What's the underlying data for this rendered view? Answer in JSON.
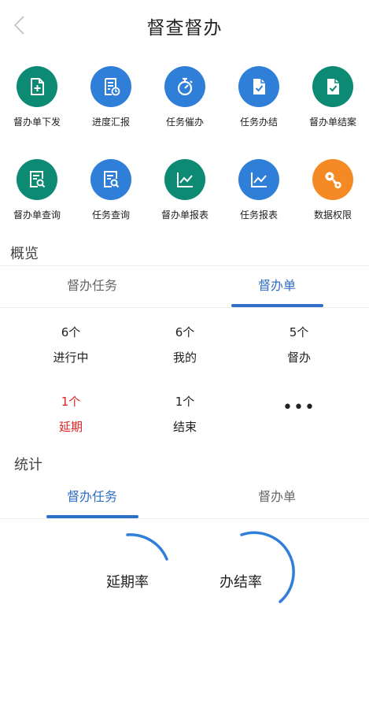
{
  "header": {
    "title": "督查督办"
  },
  "grid_row1": [
    {
      "label": "督办单下发",
      "icon": "doc-add-icon",
      "color": "#0c8a74"
    },
    {
      "label": "进度汇报",
      "icon": "report-clock-icon",
      "color": "#2f7fd9"
    },
    {
      "label": "任务催办",
      "icon": "stopwatch-icon",
      "color": "#2f7fd9"
    },
    {
      "label": "任务办结",
      "icon": "doc-check-icon",
      "color": "#2f7fd9"
    },
    {
      "label": "督办单结案",
      "icon": "doc-check-icon",
      "color": "#0c8a74"
    }
  ],
  "grid_row2": [
    {
      "label": "督办单查询",
      "icon": "doc-search-icon",
      "color": "#0c8a74"
    },
    {
      "label": "任务查询",
      "icon": "doc-search-icon",
      "color": "#2f7fd9"
    },
    {
      "label": "督办单报表",
      "icon": "line-chart-icon",
      "color": "#0c8a74"
    },
    {
      "label": "任务报表",
      "icon": "line-chart-icon",
      "color": "#2f7fd9"
    },
    {
      "label": "数据权限",
      "icon": "key-gear-icon",
      "color": "#f58a25"
    }
  ],
  "overview": {
    "title": "概览",
    "tabs": [
      "督办任务",
      "督办单"
    ],
    "active_tab": 1,
    "stats": [
      {
        "num": "6个",
        "label": "进行中"
      },
      {
        "num": "6个",
        "label": "我的"
      },
      {
        "num": "5个",
        "label": "督办"
      },
      {
        "num": "1个",
        "label": "延期",
        "color": "#e02020"
      },
      {
        "num": "1个",
        "label": "结束"
      }
    ],
    "more": "•••"
  },
  "statistics": {
    "title": "统计",
    "tabs": [
      "督办任务",
      "督办单"
    ],
    "active_tab": 0,
    "gauges": [
      {
        "label": "延期率",
        "color": "#2f7fd9"
      },
      {
        "label": "办结率",
        "color": "#2f7fd9"
      }
    ]
  },
  "colors": {
    "accent": "#2f6fc7",
    "teal": "#0c8a74",
    "blue": "#2f7fd9",
    "orange": "#f58a25",
    "delay": "#e02020"
  }
}
